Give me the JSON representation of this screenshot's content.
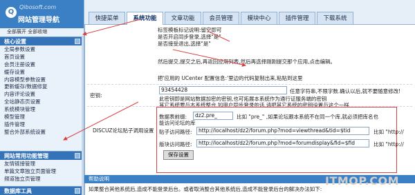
{
  "logo": {
    "domain": "Qibosoft.com",
    "title": "网站管理导航",
    "mark": "Q"
  },
  "sidebar": {
    "expand_label": "全部展开 全部收缩",
    "sections": [
      {
        "title": "核心设置",
        "items": [
          "全局参数设置",
          "首页设置",
          "会员注册设置",
          "缓存设置",
          "内容模型参数设置",
          "更新缓存/数据修复",
          "内容评论设置",
          "全站静态页设置",
          "系统模块管理",
          "模型管理",
          "插件管理",
          "整合外部系统设置"
        ]
      },
      {
        "title": "网站常用功能管理",
        "items": [
          "友情链接管理",
          "单篇文章独立页面管理",
          "频道独立页管理"
        ]
      },
      {
        "title": "数据库工具",
        "items": []
      }
    ]
  },
  "tabs": [
    "快捷菜单",
    "系统功能",
    "文章功能",
    "会员管理",
    "模块中心",
    "插件管理",
    "下载系统"
  ],
  "active_tab": "系统功能",
  "content": {
    "top_lines": [
      "标签模板标记说明:留空即可",
      "是否开启同步登录,选择\"是\"",
      "是否接受退出,选择\"是\"",
      "然后提交,提交之后,再返回应用列表,然后再选择刚刚提交那个应用,点击编辑。",
      "把'应用的 UCenter 配置信息:'里边的代码复制出来,粘贴到这里"
    ],
    "secret": {
      "label": "密钥:",
      "value": "93454428",
      "note": "任意字符串,不限字数.确认以后,就不要随意修改!",
      "desc_lines": [
        "此密钥即是网站数据加密的密钥,也可拓展本系统作为通行证服务端的密钥",
        "其它系统要与本系统整合,如用户同步登录的话,请把其它系统的密钥设置与这个一样"
      ]
    },
    "discuz": {
      "label": "DISCUZ论坛贴子调用设置",
      "prefix_label": "数据表前缀:",
      "prefix_value": "dz2.pre_",
      "prefix_note": "比如 \"pre_\" ,如果论坛跟本系统不在同一个库,就必须把库名也",
      "prefix_note2": "能访问论坛的库",
      "post_label": "贴子访问路径:",
      "post_value": "http://localhost/dz2/forum.php?mod=viewthread&tid=$tid",
      "post_note": "比如 \"http://",
      "board_label": "版块访问路径:",
      "board_value": "http://localhost/dz2/forum.php?mod=forumdisplay&fid=$fid",
      "board_note": "比如 \"http://"
    },
    "save_label": "保存设置",
    "help_title": "帮助说明",
    "help_text": "如果整合其他系统后,造成不能登录后台。或者取消整合其他系统后,造成不能登录后台的解决办法如下:"
  },
  "watermark": "ITMOP.COM",
  "colors": {
    "sidebar_head": "#3473b8",
    "logo_bg": "#3b7fc4",
    "annotation": "#d94040"
  }
}
